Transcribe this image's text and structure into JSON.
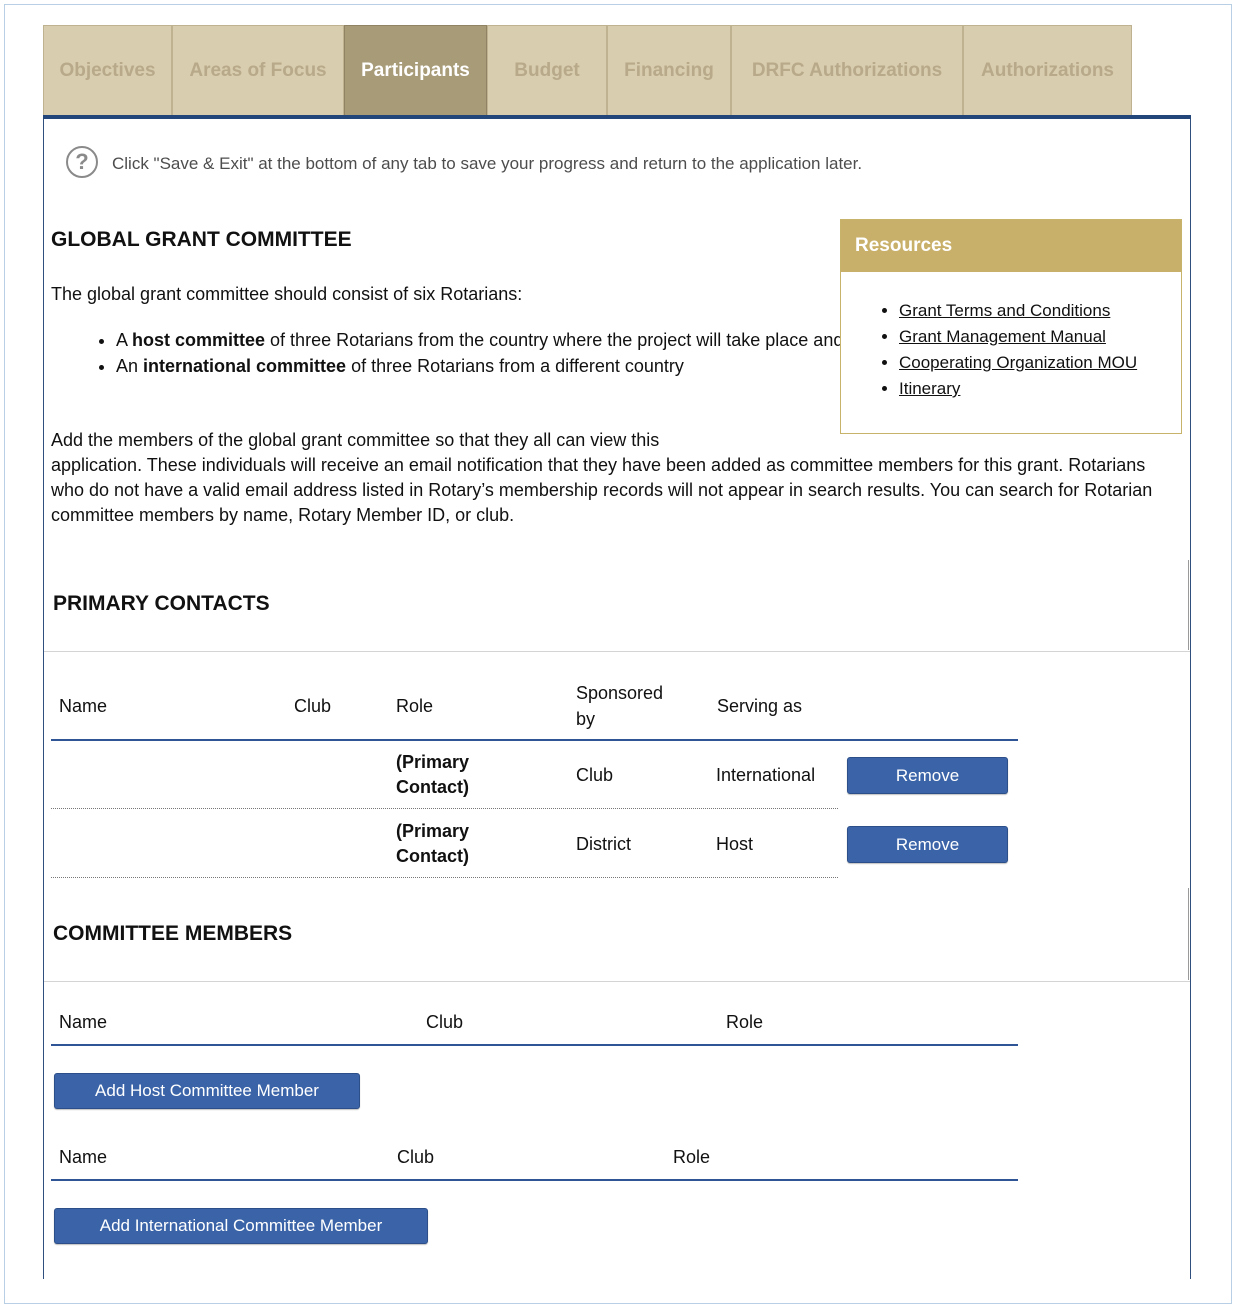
{
  "tabs": [
    {
      "label": "Objectives"
    },
    {
      "label": "Areas of Focus"
    },
    {
      "label": "Participants"
    },
    {
      "label": "Budget"
    },
    {
      "label": "Financing"
    },
    {
      "label": "DRFC Authorizations"
    },
    {
      "label": "Authorizations"
    }
  ],
  "active_tab": "Participants",
  "help": {
    "icon_glyph": "?",
    "text": "Click \"Save & Exit\" at the bottom of any tab to save your progress and return to the application later."
  },
  "committee": {
    "title": "GLOBAL GRANT COMMITTEE",
    "intro": "The global grant committee should consist of six Rotarians:",
    "bullet1_pre": "A ",
    "bullet1_bold": "host committee",
    "bullet1_post": " of three Rotarians from the country where the project will take place and",
    "bullet2_pre": "An ",
    "bullet2_bold": "international committee",
    "bullet2_post": " of three Rotarians from a different country",
    "description_line1": "Add the members of the global grant committee so that they all can view this",
    "description_rest": "application. These individuals will receive an email notification that they have been added as committee members for this grant. Rotarians who do not have a valid email address listed in Rotary’s membership records will not appear in search results. You can search for Rotarian committee members by name, Rotary Member ID, or club."
  },
  "resources": {
    "title": "Resources",
    "links": [
      {
        "label": "Grant Terms and Conditions"
      },
      {
        "label": "Grant Management Manual"
      },
      {
        "label": "Cooperating Organization MOU"
      },
      {
        "label": "Itinerary"
      }
    ]
  },
  "primary_contacts": {
    "title": "PRIMARY CONTACTS",
    "headers": {
      "name": "Name",
      "club": "Club",
      "role": "Role",
      "sponsored_line1": "Sponsored",
      "sponsored_line2": "by",
      "serving": "Serving as"
    },
    "rows": [
      {
        "name": "",
        "club": "",
        "role_line1": "(Primary",
        "role_line2": "Contact)",
        "sponsored": "Club",
        "serving": "International",
        "button": "Remove"
      },
      {
        "name": "",
        "club": "",
        "role_line1": "(Primary",
        "role_line2": "Contact)",
        "sponsored": "District",
        "serving": "Host",
        "button": "Remove"
      }
    ]
  },
  "committee_members": {
    "title": "COMMITTEE MEMBERS",
    "host": {
      "name": "Name",
      "club": "Club",
      "role": "Role",
      "button": "Add Host Committee Member"
    },
    "international": {
      "name": "Name",
      "club": "Club",
      "role": "Role",
      "button": "Add International Committee Member"
    }
  },
  "colors": {
    "tab_bg": "#d8cdae",
    "tab_active_bg": "#a89c78",
    "tab_rule": "#23467a",
    "resources_header": "#c9b06a",
    "button_bg": "#3b64a8"
  }
}
